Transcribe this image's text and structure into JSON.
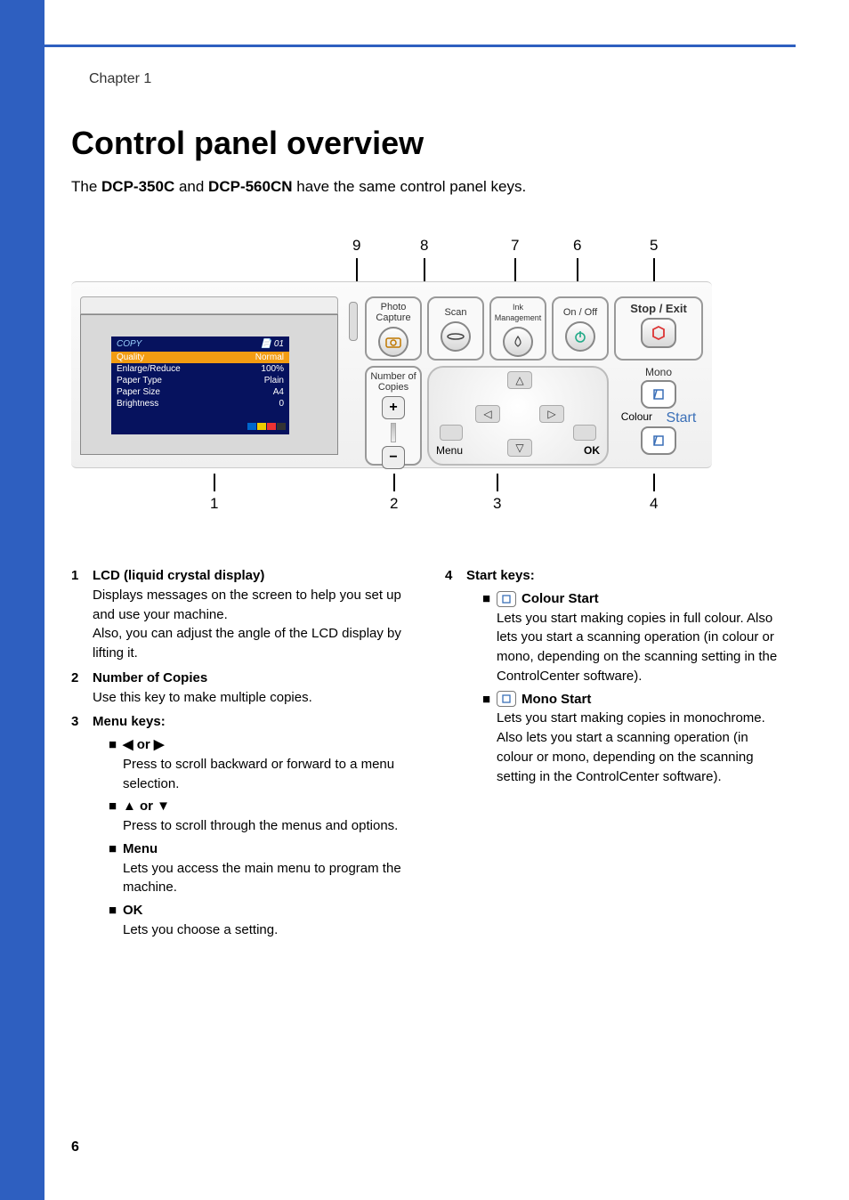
{
  "chapter": "Chapter 1",
  "heading": "Control panel overview",
  "intro_pre": "The ",
  "intro_model1": "DCP-350C",
  "intro_mid": " and ",
  "intro_model2": "DCP-560CN",
  "intro_post": " have the same control panel keys.",
  "page_number": "6",
  "callouts_top": {
    "c9": "9",
    "c8": "8",
    "c7": "7",
    "c6": "6",
    "c5": "5"
  },
  "callouts_bottom": {
    "c1": "1",
    "c2": "2",
    "c3": "3",
    "c4": "4"
  },
  "panel": {
    "photo_capture": "Photo\nCapture",
    "scan": "Scan",
    "ink": "Ink\nManagement",
    "onoff": "On / Off",
    "stop": "Stop / Exit",
    "copies": "Number of\nCopies",
    "menu": "Menu",
    "ok": "OK",
    "mono": "Mono",
    "colour": "Colour",
    "start": "Start"
  },
  "lcd": {
    "title": "COPY",
    "count": "01",
    "r1a": "Quality",
    "r1b": "Normal",
    "r2a": "Enlarge/Reduce",
    "r2b": "100%",
    "r3a": "Paper Type",
    "r3b": "Plain",
    "r4a": "Paper Size",
    "r4b": "A4",
    "r5a": "Brightness",
    "r5b": "0"
  },
  "desc": {
    "i1": {
      "n": "1",
      "title": "LCD (liquid crystal display)",
      "p1": "Displays messages on the screen to help you set up and use your machine.",
      "p2": "Also, you can adjust the angle of the LCD display by lifting it."
    },
    "i2": {
      "n": "2",
      "title": "Number of Copies",
      "p1": "Use this key to make multiple copies."
    },
    "i3": {
      "n": "3",
      "title": "Menu keys:",
      "s1_label": "◀ or ▶",
      "s1_text": "Press to scroll backward or forward to a menu selection.",
      "s2_label": "▲ or ▼",
      "s2_text": "Press to scroll through the menus and options.",
      "s3_label": "Menu",
      "s3_text": "Lets you access the main menu to program the machine.",
      "s4_label": "OK",
      "s4_text": "Lets you choose a setting."
    },
    "i4": {
      "n": "4",
      "title": "Start keys:",
      "s1_label": "Colour Start",
      "s1_text": "Lets you start making copies in full colour. Also lets you start a scanning operation (in colour or mono, depending on the scanning setting in the ControlCenter software).",
      "s2_label": "Mono Start",
      "s2_text": "Lets you start making copies in monochrome. Also lets you start a scanning operation (in colour or mono, depending on the scanning setting in the ControlCenter software)."
    }
  }
}
